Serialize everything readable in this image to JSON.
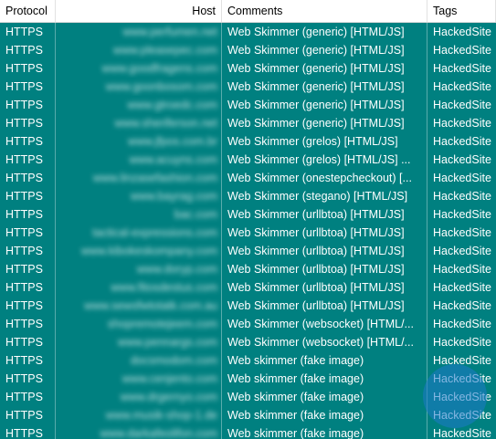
{
  "headers": {
    "protocol": "Protocol",
    "host": "Host",
    "comments": "Comments",
    "tags": "Tags"
  },
  "rows": [
    {
      "protocol": "HTTPS",
      "host": "www.perfumen.net",
      "comments": "Web Skimmer (generic) [HTML/JS]",
      "tags": "HackedSite"
    },
    {
      "protocol": "HTTPS",
      "host": "www.pleasepec.com",
      "comments": "Web Skimmer (generic) [HTML/JS]",
      "tags": "HackedSite"
    },
    {
      "protocol": "HTTPS",
      "host": "www.goodfragens.com",
      "comments": "Web Skimmer (generic) [HTML/JS]",
      "tags": "HackedSite"
    },
    {
      "protocol": "HTTPS",
      "host": "www.goonbosom.com",
      "comments": "Web Skimmer (generic) [HTML/JS]",
      "tags": "HackedSite"
    },
    {
      "protocol": "HTTPS",
      "host": "www.gtroedc.com",
      "comments": "Web Skimmer (generic) [HTML/JS]",
      "tags": "HackedSite"
    },
    {
      "protocol": "HTTPS",
      "host": "www.sheriferson.net",
      "comments": "Web Skimmer (generic) [HTML/JS]",
      "tags": "HackedSite"
    },
    {
      "protocol": "HTTPS",
      "host": "www.jfpos.com.br",
      "comments": "Web Skimmer (grelos) [HTML/JS]",
      "tags": "HackedSite"
    },
    {
      "protocol": "HTTPS",
      "host": "www.acuyns.com",
      "comments": "Web Skimmer (grelos) [HTML/JS] ...",
      "tags": "HackedSite"
    },
    {
      "protocol": "HTTPS",
      "host": "www.linzasefashion.com",
      "comments": "Web Skimmer (onestepcheckout) [...",
      "tags": "HackedSite"
    },
    {
      "protocol": "HTTPS",
      "host": "www.bayrag.com",
      "comments": "Web Skimmer (stegano) [HTML/JS]",
      "tags": "HackedSite"
    },
    {
      "protocol": "HTTPS",
      "host": "bac.com",
      "comments": "Web Skimmer (urllbtoa) [HTML/JS]",
      "tags": "HackedSite"
    },
    {
      "protocol": "HTTPS",
      "host": "tactical-expressions.com",
      "comments": "Web Skimmer (urllbtoa) [HTML/JS]",
      "tags": "HackedSite"
    },
    {
      "protocol": "HTTPS",
      "host": "www.kibokeskompany.com",
      "comments": "Web Skimmer (urllbtoa) [HTML/JS]",
      "tags": "HackedSite"
    },
    {
      "protocol": "HTTPS",
      "host": "www.doryp.com",
      "comments": "Web Skimmer (urllbtoa) [HTML/JS]",
      "tags": "HackedSite"
    },
    {
      "protocol": "HTTPS",
      "host": "www.fitosdestus.com",
      "comments": "Web Skimmer (urllbtoa) [HTML/JS]",
      "tags": "HackedSite"
    },
    {
      "protocol": "HTTPS",
      "host": "www.sewsfwtotatk.com.au",
      "comments": "Web Skimmer (urllbtoa) [HTML/JS]",
      "tags": "HackedSite"
    },
    {
      "protocol": "HTTPS",
      "host": "shopremotejeem.com",
      "comments": "Web Skimmer (websocket) [HTML/...",
      "tags": "HackedSite"
    },
    {
      "protocol": "HTTPS",
      "host": "www.pennargs.com",
      "comments": "Web Skimmer (websocket) [HTML/...",
      "tags": "HackedSite"
    },
    {
      "protocol": "HTTPS",
      "host": "docsmodom.com",
      "comments": "Web skimmer (fake image)",
      "tags": "HackedSite"
    },
    {
      "protocol": "HTTPS",
      "host": "www.cenjento.com",
      "comments": "Web skimmer (fake image)",
      "tags": "HackedSite"
    },
    {
      "protocol": "HTTPS",
      "host": "www.drgernyo.com",
      "comments": "Web skimmer (fake image)",
      "tags": "HackedSite"
    },
    {
      "protocol": "HTTPS",
      "host": "www.musik-shop-1.de",
      "comments": "Web skimmer (fake image)",
      "tags": "HackedSite"
    },
    {
      "protocol": "HTTPS",
      "host": "www.darkafeolifon.com",
      "comments": "Web skimmer (fake image)",
      "tags": "HackedSite"
    }
  ]
}
